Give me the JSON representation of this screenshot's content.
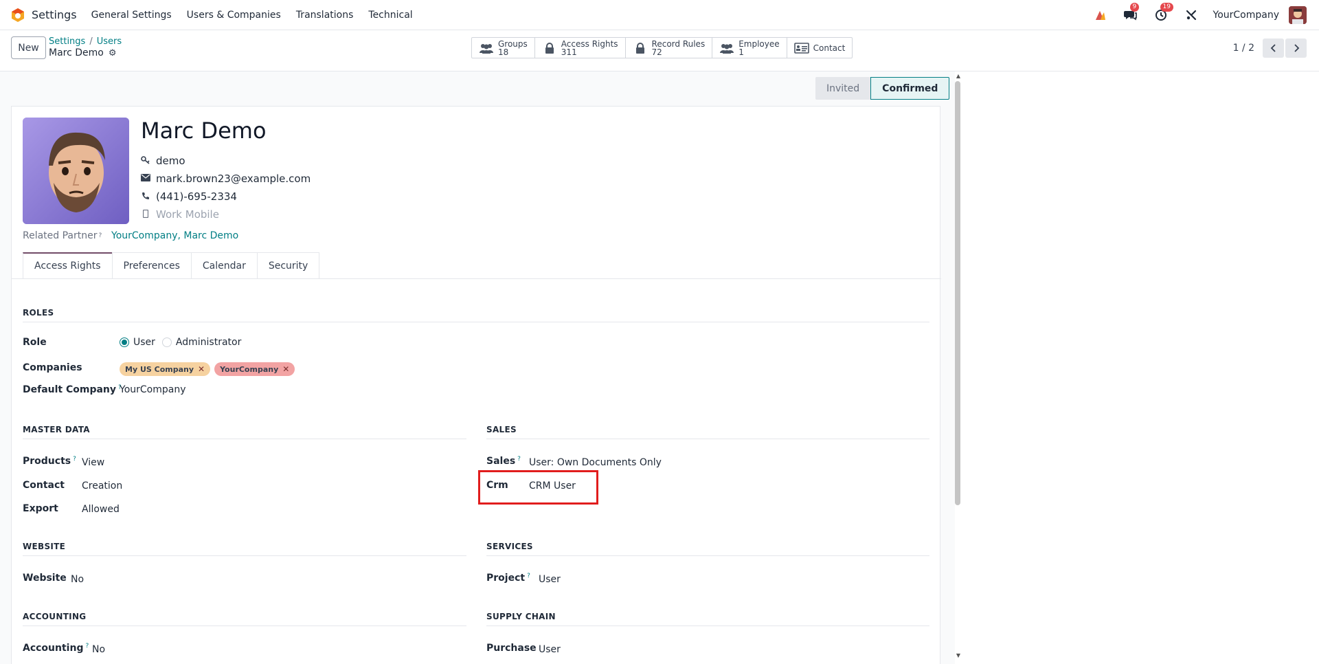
{
  "navbar": {
    "app_name": "Settings",
    "menu": [
      "General Settings",
      "Users & Companies",
      "Translations",
      "Technical"
    ],
    "messages_badge": "9",
    "activity_badge": "19",
    "company": "YourCompany"
  },
  "control": {
    "new_label": "New",
    "breadcrumb": [
      "Settings",
      "Users"
    ],
    "current": "Marc Demo",
    "smart_buttons": [
      {
        "label": "Groups",
        "value": "18",
        "icon": "users-icon"
      },
      {
        "label": "Access Rights",
        "value": "311",
        "icon": "lock-icon"
      },
      {
        "label": "Record Rules",
        "value": "72",
        "icon": "lock-icon"
      },
      {
        "label": "Employee",
        "value": "1",
        "icon": "users-icon"
      },
      {
        "label": "Contact",
        "value": "",
        "icon": "id-card-icon"
      }
    ],
    "pager": "1 / 2"
  },
  "status": {
    "invited": "Invited",
    "confirmed": "Confirmed"
  },
  "user": {
    "name": "Marc Demo",
    "login": "demo",
    "email": "mark.brown23@example.com",
    "phone": "(441)-695-2334",
    "mobile_placeholder": "Work Mobile",
    "related_partner_label": "Related Partner",
    "related_partner_value": "YourCompany, Marc Demo"
  },
  "tabs": [
    "Access Rights",
    "Preferences",
    "Calendar",
    "Security"
  ],
  "roles": {
    "title": "ROLES",
    "role_label": "Role",
    "role_options": [
      "User",
      "Administrator"
    ],
    "companies_label": "Companies",
    "companies": [
      {
        "name": "My US Company",
        "color": "#f6d2a0"
      },
      {
        "name": "YourCompany",
        "color": "#f2a3a3"
      }
    ],
    "default_company_label": "Default Company",
    "default_company_value": "YourCompany"
  },
  "master_data": {
    "title": "MASTER DATA",
    "fields": [
      {
        "label": "Products",
        "value": "View",
        "help": true
      },
      {
        "label": "Contact",
        "value": "Creation",
        "help": false
      },
      {
        "label": "Export",
        "value": "Allowed",
        "help": false
      }
    ]
  },
  "sales": {
    "title": "SALES",
    "fields": [
      {
        "label": "Sales",
        "value": "User: Own Documents Only",
        "help": true
      },
      {
        "label": "Crm",
        "value": "CRM User",
        "help": false
      }
    ]
  },
  "website": {
    "title": "WEBSITE",
    "label": "Website",
    "value": "No"
  },
  "services": {
    "title": "SERVICES",
    "label": "Project",
    "value": "User"
  },
  "accounting": {
    "title": "ACCOUNTING",
    "label": "Accounting",
    "value": "No"
  },
  "supply_chain": {
    "title": "SUPPLY CHAIN",
    "label": "Purchase",
    "value": "User"
  },
  "help_mark": "?"
}
